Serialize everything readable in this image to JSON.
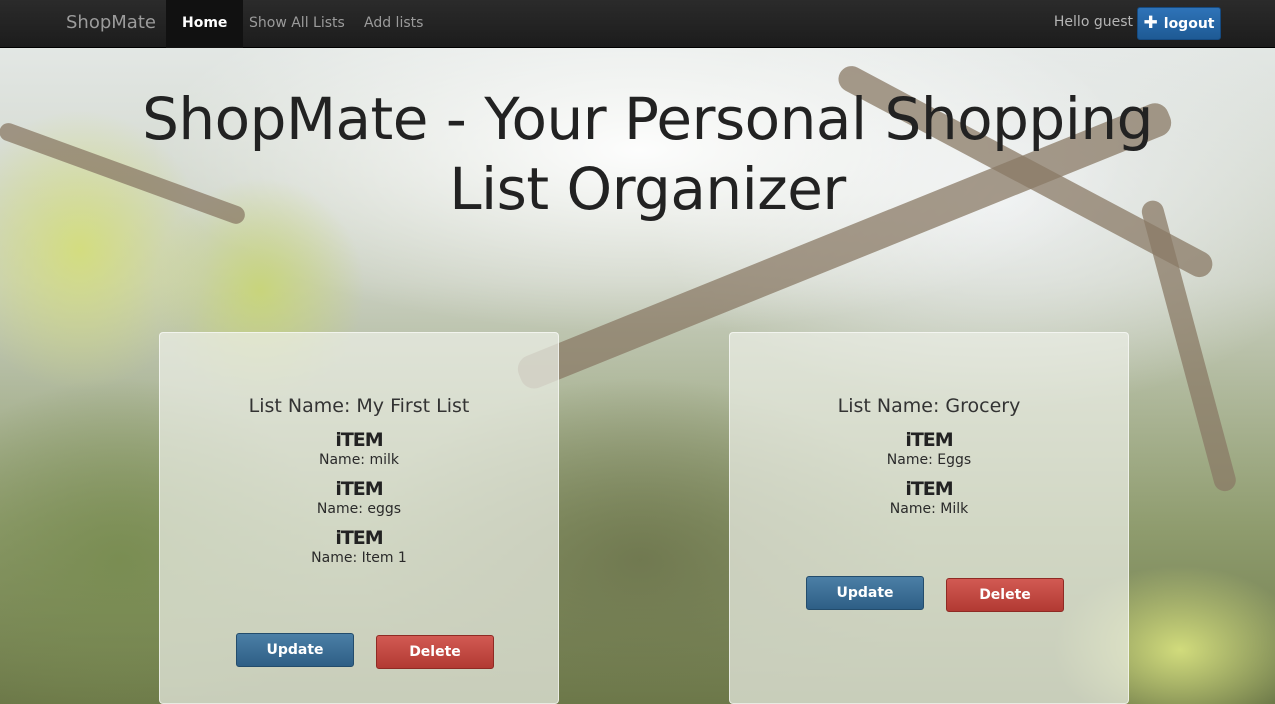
{
  "navbar": {
    "brand": "ShopMate",
    "items": [
      {
        "label": "Home",
        "active": true
      },
      {
        "label": "Show All Lists",
        "active": false
      },
      {
        "label": "Add lists",
        "active": false
      }
    ],
    "greeting": "Hello guest",
    "logout_label": "logout",
    "logout_icon": "plus-icon",
    "logout_color": "#2468a8"
  },
  "hero": {
    "line1": "ShopMate - Your Personal Shopping",
    "line2": "List Organizer"
  },
  "lists": [
    {
      "name": "List Name: My First List",
      "items": [
        {
          "tag": "iTEM",
          "name": "Name: milk"
        },
        {
          "tag": "iTEM",
          "name": "Name: eggs"
        },
        {
          "tag": "iTEM",
          "name": "Name: Item 1"
        }
      ],
      "update_label": "Update",
      "delete_label": "Delete"
    },
    {
      "name": "List Name: Grocery",
      "items": [
        {
          "tag": "iTEM",
          "name": "Name: Eggs"
        },
        {
          "tag": "iTEM",
          "name": "Name: Milk"
        }
      ],
      "update_label": "Update",
      "delete_label": "Delete"
    }
  ],
  "colors": {
    "update_button": "#3a6d94",
    "delete_button": "#c24a43"
  }
}
